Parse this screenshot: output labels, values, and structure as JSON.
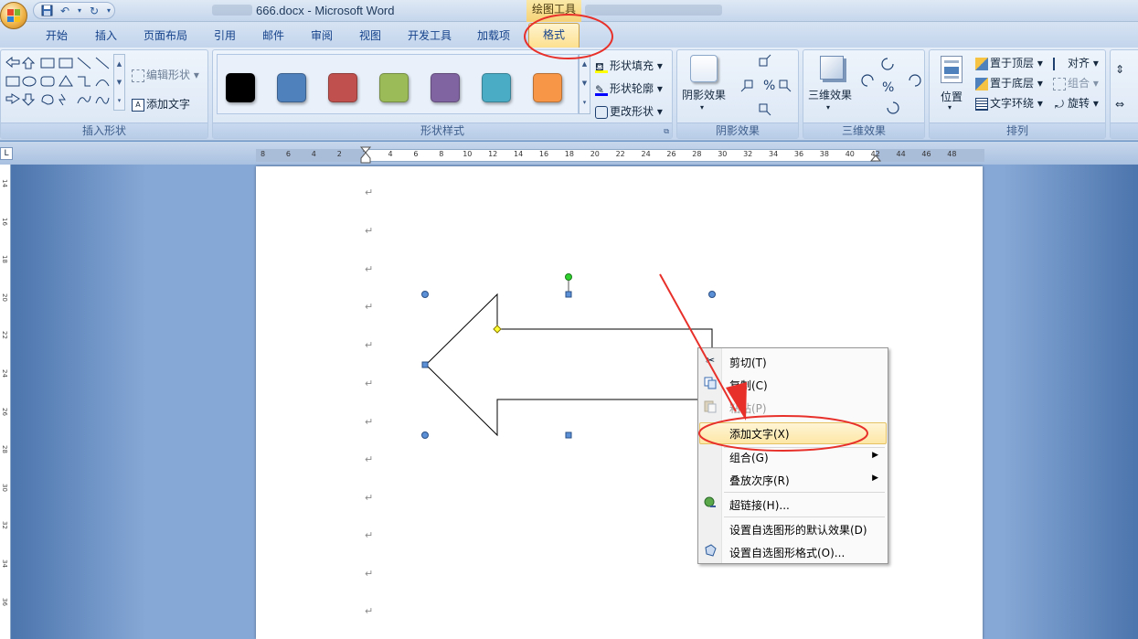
{
  "titlebar": {
    "title": "666.docx - Microsoft Word",
    "contextual_tab_group": "绘图工具"
  },
  "tabs": [
    "开始",
    "插入",
    "页面布局",
    "引用",
    "邮件",
    "审阅",
    "视图",
    "开发工具",
    "加载项"
  ],
  "active_tab": "格式",
  "ribbon": {
    "insert_shapes": {
      "label": "插入形状",
      "edit_shape": "编辑形状",
      "add_text": "添加文字"
    },
    "shape_styles": {
      "label": "形状样式",
      "swatches": [
        "#000000",
        "#4f81bd",
        "#c0504d",
        "#9bbb59",
        "#8064a2",
        "#4bacc6",
        "#f79646"
      ],
      "shape_fill": "形状填充",
      "shape_outline": "形状轮廓",
      "change_shape": "更改形状"
    },
    "shadow_effects": {
      "label": "阴影效果",
      "button": "阴影效果"
    },
    "threed_effects": {
      "label": "三维效果",
      "button": "三维效果"
    },
    "arrange": {
      "label": "排列",
      "position": "位置",
      "bring_to_front": "置于顶层",
      "send_to_back": "置于底层",
      "text_wrapping": "文字环绕",
      "align": "对齐",
      "group": "组合",
      "rotate": "旋转"
    }
  },
  "ruler": {
    "ticks": [
      "8",
      "6",
      "4",
      "2",
      "2",
      "4",
      "6",
      "8",
      "10",
      "12",
      "14",
      "16",
      "18",
      "20",
      "22",
      "24",
      "26",
      "28",
      "30",
      "32",
      "34",
      "36",
      "38",
      "40",
      "42",
      "44",
      "46",
      "48"
    ],
    "vticks": [
      "14",
      "16",
      "18",
      "20",
      "22",
      "24",
      "26",
      "28",
      "30",
      "32",
      "34",
      "36"
    ]
  },
  "context_menu": {
    "items": [
      {
        "label": "剪切(T)",
        "enabled": true,
        "icon": "scissors-icon"
      },
      {
        "label": "复制(C)",
        "enabled": true,
        "icon": "copy-icon"
      },
      {
        "label": "粘贴(P)",
        "enabled": false,
        "icon": "paste-icon"
      },
      {
        "label": "添加文字(X)",
        "enabled": true,
        "highlighted": true
      },
      {
        "label": "组合(G)",
        "enabled": true,
        "submenu": true
      },
      {
        "label": "叠放次序(R)",
        "enabled": true,
        "submenu": true
      },
      {
        "label": "超链接(H)...",
        "enabled": true,
        "icon": "hyperlink-icon"
      },
      {
        "label": "设置自选图形的默认效果(D)",
        "enabled": true
      },
      {
        "label": "设置自选图形格式(O)...",
        "enabled": true,
        "icon": "format-shape-icon"
      }
    ]
  },
  "colors": {
    "annotation_red": "#e8302a",
    "highlight": "#fde7a6",
    "ribbon_blue": "#15428b"
  }
}
